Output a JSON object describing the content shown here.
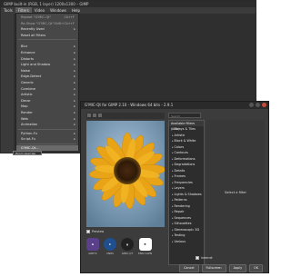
{
  "gimp": {
    "title": "GIMP built-in (RGB, 1 layer) 1200x1300 – GIMP",
    "menubar": [
      "Tools",
      "Filters",
      "Video",
      "Windows",
      "Help"
    ],
    "active_menu": "Filters"
  },
  "filters_menu": {
    "top_items": [
      {
        "label": "Repeat \"G'MIC-Qt\"",
        "shortcut": "Ctrl+F"
      },
      {
        "label": "Re-Show \"G'MIC-Qt\"",
        "shortcut": "Shift+Ctrl+F"
      },
      {
        "label": "Recently Used",
        "submenu": true
      },
      {
        "label": "Reset all Filters"
      }
    ],
    "groups": [
      "Blur",
      "Enhance",
      "Distorts",
      "Light and Shadow",
      "Noise",
      "Edge-Detect",
      "Generic",
      "Combine",
      "Artistic",
      "Decor",
      "Map",
      "Render",
      "Web",
      "Animation"
    ],
    "bottom_items": [
      "Python-Fu",
      "Script-Fu"
    ],
    "gmic_item": "G'MIC-Qt...",
    "highlighted": "G'MIC-Qt...",
    "tooltip": "Zoom exercise"
  },
  "gmic": {
    "title": "G'MIC-Qt for GIMP 2.10 - Windows 64 bits - 2.9.1",
    "search_placeholder": "Search",
    "filters_header": "Available filters (%%)",
    "filters": [
      "Arrays & Tiles",
      "Artistic",
      "Black & White",
      "Colors",
      "Contours",
      "Deformations",
      "Degradations",
      "Details",
      "Frames",
      "Frequencies",
      "Layers",
      "Lights & Shadows",
      "Patterns",
      "Rendering",
      "Repair",
      "Sequences",
      "Silhouettes",
      "Stereoscopic 3D",
      "Testing",
      "Various"
    ],
    "params_note": "Select a filter",
    "preview_label": "Preview",
    "internet_label": "Internet",
    "status": "",
    "logos": [
      {
        "caption": "GREYC",
        "color": "#5a3f8a"
      },
      {
        "caption": "CNRS",
        "color": "#1f4f8f"
      },
      {
        "caption": "GMIC-QT",
        "color": "#222222"
      },
      {
        "caption": "ENSI CAEN",
        "color": "#ffffff"
      }
    ],
    "buttons": [
      "Cancel",
      "Fullscreen",
      "Apply",
      "OK"
    ]
  }
}
